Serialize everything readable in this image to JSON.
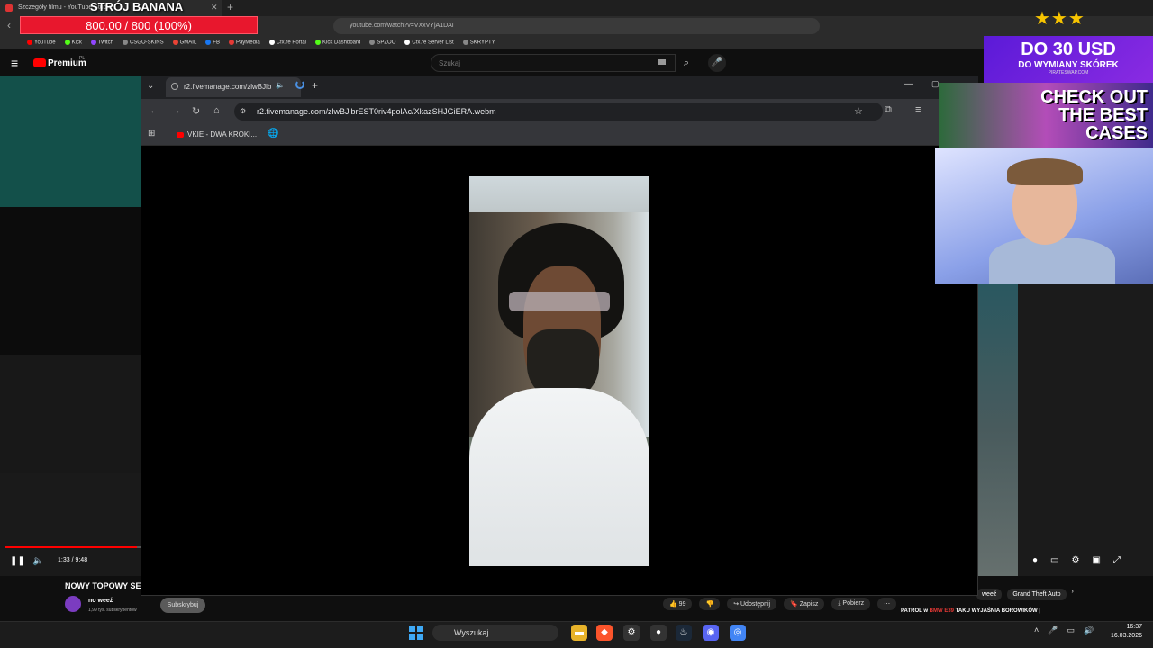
{
  "outer_browser": {
    "tab_title": "Szczegóły filmu - YouTube Studio",
    "url": "youtube.com/watch?v=VXxVYjA1DAI",
    "bookmarks": [
      {
        "label": "YouTube",
        "color": "#ff0000"
      },
      {
        "label": "Kick",
        "color": "#53fc18"
      },
      {
        "label": "Twitch",
        "color": "#9146ff"
      },
      {
        "label": "CSGO-SKINS",
        "color": "#888888"
      },
      {
        "label": "GMAIL",
        "color": "#ea4335"
      },
      {
        "label": "FB",
        "color": "#1877f2"
      },
      {
        "label": "PayMedia",
        "color": "#e53935"
      },
      {
        "label": "Cfx.re Portal",
        "color": "#ffffff"
      },
      {
        "label": "Kick Dashboard",
        "color": "#53fc18"
      },
      {
        "label": "SPZOO",
        "color": "#888888"
      },
      {
        "label": "Cfx.re Server List",
        "color": "#ffffff"
      },
      {
        "label": "SKRYPTY",
        "color": "#888888"
      }
    ]
  },
  "overlay": {
    "title": "STRÓJ BANANA",
    "hp_text": "800.00 / 800 (100%)",
    "stars": "★★★",
    "promo1_big": "DO 30 USD",
    "promo1_small": "DO WYMIANY SKÓREK",
    "promo1_site": "PIRATESWAP.COM",
    "promo2_text": "CHECK OUT THE BEST CASES"
  },
  "youtube": {
    "logo_text": "Premium",
    "logo_region": "PL",
    "search_placeholder": "Szukaj",
    "time": "1:33 / 9:48",
    "progress_fraction": 0.97,
    "video_title": "NOWY TOPOWY SE",
    "channel": "no weeź",
    "subscribers": "1,99 tys. subskrybentów",
    "subscribe_label": "Subskrybuj",
    "likes": "99",
    "share_label": "Udostępnij",
    "save_label": "Zapisz",
    "download_label": "Pobierz",
    "chips": [
      "weeź",
      "Grand Theft Auto"
    ],
    "reco_prefix": "PATROL w",
    "reco_highlight": "BMW E39",
    "reco_rest": "TAKU WYJAŚNIA BOROWIKÓW |"
  },
  "inner_browser": {
    "tab_title": "r2.fivemanage.com/zlwBJlb",
    "url": "r2.fivemanage.com/zlwBJlbrEST0riv4polAc/XkazSHJGiERA.webm",
    "bookmark1": "VKIE - DWA KROKI..."
  },
  "taskbar": {
    "search_label": "Wyszukaj",
    "time": "16:37",
    "date": "16.03.2026"
  }
}
